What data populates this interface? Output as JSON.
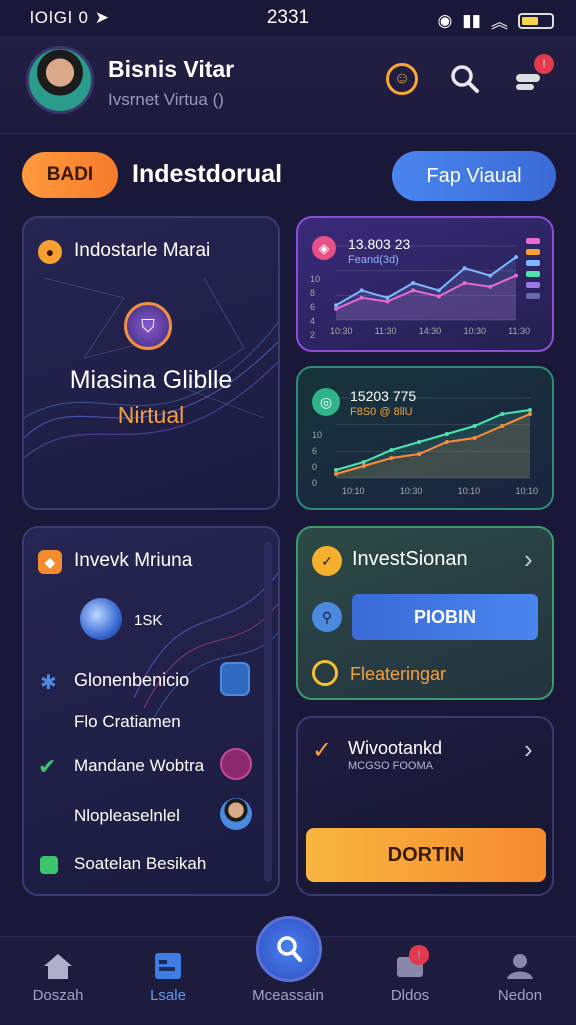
{
  "status_bar": {
    "left": "lOlGl 0",
    "time": "2331"
  },
  "header": {
    "title": "Bisnis Vitar",
    "subtitle": "Ivsrnet Virtua ()"
  },
  "actions": {
    "left_pill": "BADI",
    "section_title": "Indestdorual",
    "right_pill": "Fap Viaual"
  },
  "card_main": {
    "title": "Indostarle Marai",
    "headline": "Miasina Gliblle",
    "subline": "Nirtual"
  },
  "chart_top": {
    "value": "13.803 23",
    "label": "Feand(3d)",
    "y_ticks": [
      "10",
      "8",
      "6",
      "4",
      "2",
      "0"
    ],
    "x_ticks": [
      "10:30",
      "11:30",
      "14:30",
      "10:30",
      "11:30"
    ]
  },
  "chart_bottom": {
    "value": "15203 775",
    "label": "F8S0 @ 8llU",
    "y_ticks": [
      "10",
      "6",
      "0",
      "0"
    ],
    "x_ticks": [
      "10:10",
      "10:30",
      "10:10",
      "10:10"
    ]
  },
  "chart_data": [
    {
      "type": "line",
      "title": "13.803 23",
      "series": [
        {
          "name": "",
          "color": "#7fb6ff",
          "x": [
            0,
            1,
            2,
            3,
            4,
            5,
            6,
            7
          ],
          "values": [
            2,
            4,
            3,
            5,
            4,
            7,
            6,
            8.5
          ]
        },
        {
          "name": "",
          "color": "#e86ad0",
          "x": [
            0,
            1,
            2,
            3,
            4,
            5,
            6,
            7
          ],
          "values": [
            1.5,
            3,
            2.5,
            4,
            3.2,
            5,
            4.5,
            6
          ]
        }
      ],
      "ylim": [
        0,
        10
      ]
    },
    {
      "type": "line",
      "title": "15203 775",
      "series": [
        {
          "name": "",
          "color": "#4fe3b0",
          "x": [
            0,
            1,
            2,
            3,
            4,
            5,
            6,
            7
          ],
          "values": [
            1,
            2,
            3.5,
            4.5,
            5.5,
            6.5,
            8,
            8.5
          ]
        },
        {
          "name": "",
          "color": "#ff8a3a",
          "x": [
            0,
            1,
            2,
            3,
            4,
            5,
            6,
            7
          ],
          "values": [
            0.5,
            1.5,
            2.5,
            3,
            4.5,
            5,
            6.5,
            8
          ]
        }
      ],
      "ylim": [
        0,
        10
      ]
    }
  ],
  "card_invest": {
    "title": "Invevk Mriuna",
    "stat": "1SK",
    "items": [
      "Glonenbenicio",
      "Flo Cratiamen",
      "Mandane Wobtra",
      "Nlopleaselnlel",
      "Soatelan Besikah"
    ]
  },
  "card_signal": {
    "title": "InvestSionan",
    "button": "PIOBIN",
    "footer": "Fleateringar"
  },
  "card_promo": {
    "title": "Wivootankd",
    "subtitle": "MCGSO FOOMA",
    "button": "DORTIN"
  },
  "nav": {
    "items": [
      {
        "label": "Doszah",
        "icon": "home-icon"
      },
      {
        "label": "Lsale",
        "icon": "calendar-icon"
      },
      {
        "label": "Mceassain",
        "icon": "search-icon"
      },
      {
        "label": "Dldos",
        "icon": "inbox-icon"
      },
      {
        "label": "Nedon",
        "icon": "profile-icon"
      }
    ]
  },
  "colors": {
    "background": "#1a1838",
    "accent_orange": "#f58a2f",
    "accent_blue": "#3a6ad6",
    "accent_green": "#3c9a6a"
  }
}
